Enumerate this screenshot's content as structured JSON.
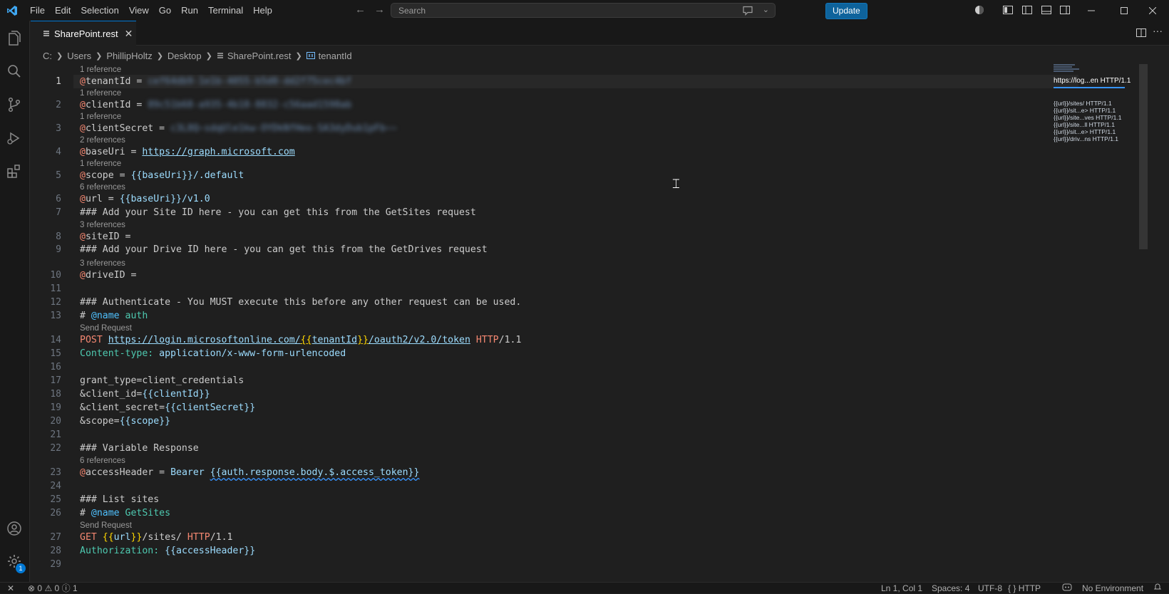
{
  "menu": [
    "File",
    "Edit",
    "Selection",
    "View",
    "Go",
    "Run",
    "Terminal",
    "Help"
  ],
  "search": {
    "placeholder": "Search"
  },
  "update_label": "Update",
  "tab": {
    "label": "SharePoint.rest"
  },
  "breadcrumb": [
    "C:",
    "Users",
    "PhillipHoltz",
    "Desktop",
    "SharePoint.rest",
    "tenantId"
  ],
  "lenses": {
    "one_ref": "1 reference",
    "two_refs": "2 references",
    "three_refs": "3 references",
    "six_refs": "6 references",
    "send": "Send Request"
  },
  "code": {
    "l1_name": "tenantId",
    "l1_value": "cef64db9-1e1b-4055-b5d0-dd2f75cec4bf",
    "l2_name": "clientId",
    "l2_value": "89c51b68-a935-4b18-8832-c56aad1598ab",
    "l3_name": "clientSecret",
    "l3_value": "c3L8Q~sdqUle1kw-OYDkNfHeo-SA3dyDub1pFb~~",
    "l4_name": "baseUri",
    "l4_value": "https://graph.microsoft.com",
    "l5_name": "scope",
    "l5_value": "{{baseUri}}/.default",
    "l6_name": "url",
    "l6_value": "{{baseUri}}/v1.0",
    "l7": "### Add your Site ID here - you can get this from the GetSites request",
    "l8_name": "siteID",
    "l9": "### Add your Drive ID here - you can get this from the GetDrives request",
    "l10_name": "driveID",
    "l12": "### Authenticate - You MUST execute this before any other request can be used.",
    "l13_tag": "@name",
    "l13_name": "auth",
    "l14_verb": "POST",
    "l14_url_a": "https://login.microsoftonline.com/",
    "l14_var": "tenantId",
    "l14_url_b": "/oauth2/v2.0/token",
    "l14_http": "HTTP",
    "l14_ver": "/1.1",
    "l15_hdr": "Content-type:",
    "l15_val": "application/x-www-form-urlencoded",
    "l17": "grant_type=client_credentials",
    "l18_a": "&client_id=",
    "l18_var": "clientId",
    "l19_a": "&client_secret=",
    "l19_var": "clientSecret",
    "l20_a": "&scope=",
    "l20_var": "scope",
    "l22": "### Variable Response",
    "l23_name": "accessHeader",
    "l23_a": "Bearer ",
    "l23_var": "{{auth.response.body.$.access_token}}",
    "l25": "### List sites",
    "l26_tag": "@name",
    "l26_name": "GetSites",
    "l27_verb": "GET",
    "l27_var": "url",
    "l27_path": "/sites/ ",
    "l27_http": "HTTP",
    "l27_ver": "/1.1",
    "l28_hdr": "Authorization:",
    "l28_var": "accessHeader"
  },
  "minimap": {
    "sticky": "https://log...en HTTP/1.1",
    "items": [
      "{{url}}/sites/ HTTP/1.1",
      "{{url}}/sit...e> HTTP/1.1",
      "{{url}}/site...ves HTTP/1.1",
      "{{url}}/site...ll HTTP/1.1",
      "{{url}}/sit...e> HTTP/1.1",
      "{{url}}/driv...ns HTTP/1.1"
    ]
  },
  "status": {
    "errors": "0",
    "warnings": "0",
    "info": "1",
    "position": "Ln 1, Col 1",
    "spaces": "Spaces: 4",
    "encoding": "UTF-8",
    "language": "HTTP",
    "environment": "No Environment",
    "settings_badge": "1"
  },
  "colors": {
    "accent": "#0078d4",
    "update_button": "#0e639c",
    "background": "#1f1f1f"
  }
}
